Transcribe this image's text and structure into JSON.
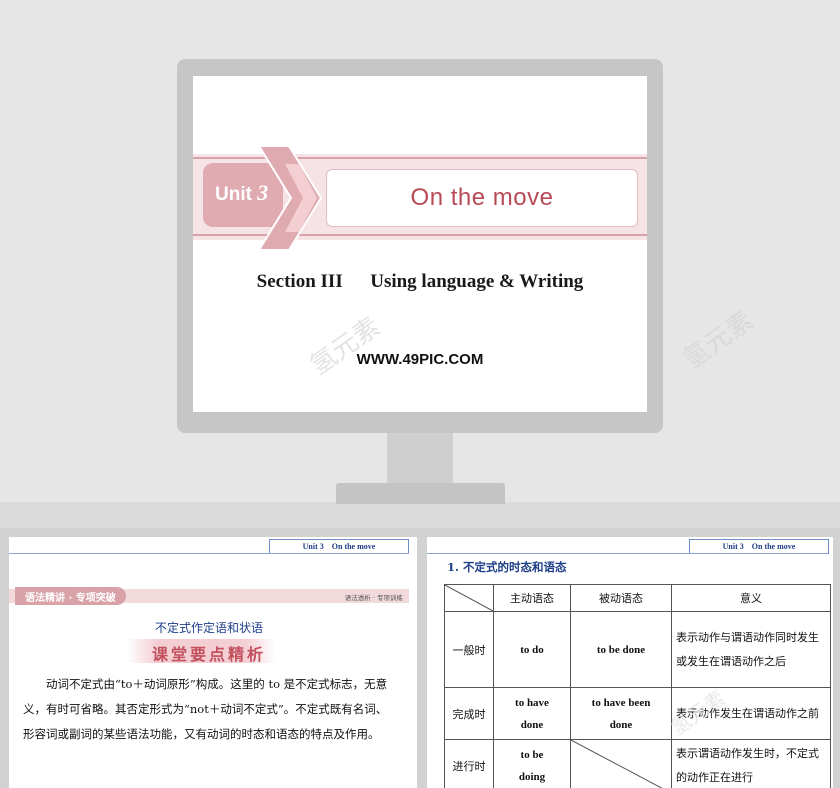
{
  "title_slide": {
    "unit_word": "Unit",
    "unit_number": "3",
    "title": "On the move",
    "section": "Section III",
    "subtitle": "Using language & Writing",
    "website": "WWW.49PIC.COM",
    "watermark": "氢元素"
  },
  "slide_left": {
    "header_tag": "Unit 3    On the move",
    "banner_left": "语法精讲 · 专项突破",
    "banner_right": "语法透析 · 专项训练",
    "heading": "不定式作定语和状语",
    "subheading": "课堂要点精析",
    "body": "动词不定式由“to＋动词原形”构成。这里的 to 是不定式标志，无意义，有时可省略。其否定形式为“not＋动词不定式”。不定式既有名词、形容词或副词的某些语法功能，又有动词的时态和语态的特点及作用。"
  },
  "slide_right": {
    "header_tag": "Unit 3    On the move",
    "section_title": "1. 不定式的时态和语态",
    "table": {
      "headers": [
        "",
        "主动语态",
        "被动语态",
        "意义"
      ],
      "rows": [
        {
          "label": "一般时",
          "active": "to do",
          "passive": "to be done",
          "meaning": "表示动作与谓语动作同时发生或发生在谓语动作之后"
        },
        {
          "label": "完成时",
          "active": "to have done",
          "passive": "to have been done",
          "meaning": "表示动作发生在谓语动作之前"
        },
        {
          "label": "进行时",
          "active": "to be doing",
          "passive": "",
          "meaning": "表示谓语动作发生时，不定式的动作正在进行"
        }
      ]
    }
  },
  "colors": {
    "accent": "#d9a1a8",
    "accent_dark": "#c77d87",
    "title_red": "#b84a57",
    "navy": "#1f3f8a",
    "blue_banner": "#2b5bb0"
  }
}
